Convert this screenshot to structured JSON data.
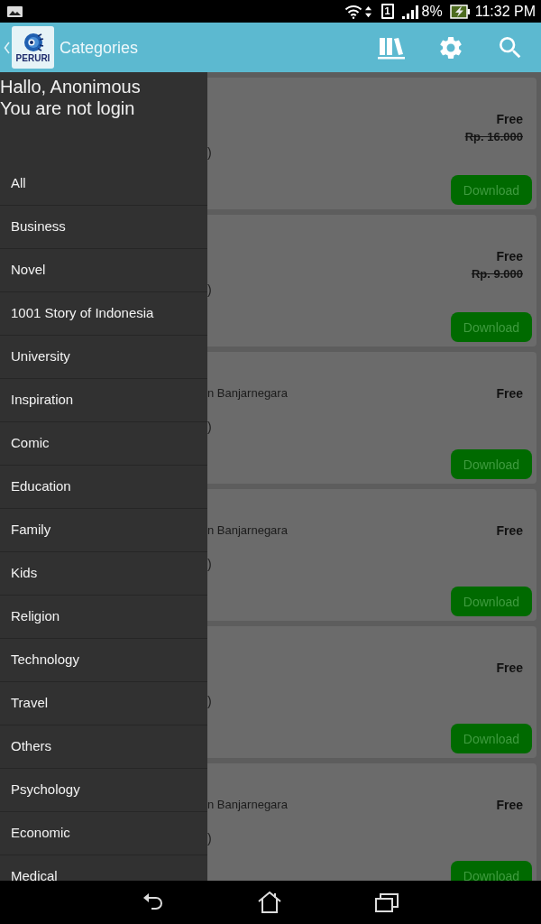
{
  "status_bar": {
    "sim_slot": "1",
    "battery": "8%",
    "time": "11:32 PM"
  },
  "app_bar": {
    "logo_text": "PERURI",
    "title": "Categories"
  },
  "drawer": {
    "greeting": "Hallo, Anonimous",
    "login_status": "You are not login",
    "categories": [
      {
        "label": "All"
      },
      {
        "label": "Business"
      },
      {
        "label": "Novel"
      },
      {
        "label": "1001 Story of Indonesia"
      },
      {
        "label": "University"
      },
      {
        "label": "Inspiration"
      },
      {
        "label": "Comic"
      },
      {
        "label": "Education"
      },
      {
        "label": "Family"
      },
      {
        "label": "Kids"
      },
      {
        "label": "Religion"
      },
      {
        "label": "Technology"
      },
      {
        "label": "Travel"
      },
      {
        "label": "Others"
      },
      {
        "label": "Psychology"
      },
      {
        "label": "Economic"
      },
      {
        "label": "Medical"
      }
    ]
  },
  "books": [
    {
      "cut_text_2": ")",
      "price": "Free",
      "original_price": "Rp. 16.000",
      "button": "Download"
    },
    {
      "cut_text_2": ")",
      "price": "Free",
      "original_price": "Rp. 9.000",
      "button": "Download"
    },
    {
      "cut_text_1": "n Banjarnegara",
      "cut_text_2": ")",
      "price": "Free",
      "button": "Download"
    },
    {
      "cut_text_1": "n Banjarnegara",
      "cut_text_2": ")",
      "price": "Free",
      "button": "Download"
    },
    {
      "cut_text_2": ")",
      "price": "Free",
      "button": "Download"
    },
    {
      "cut_text_1": "n Banjarnegara",
      "cut_text_2": ")",
      "price": "Free",
      "button": "Download"
    }
  ]
}
